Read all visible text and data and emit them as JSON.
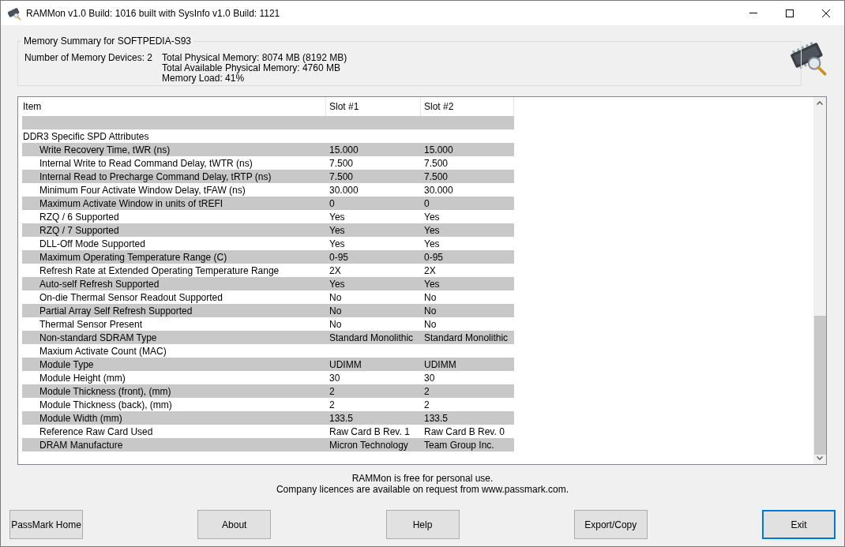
{
  "window": {
    "title": "RAMMon v1.0 Build: 1016 built with SysInfo v1.0 Build: 1121"
  },
  "summary": {
    "title": "Memory Summary for SOFTPEDIA-S93",
    "devices": "Number of Memory Devices: 2",
    "lines": [
      "Total Physical Memory: 8074 MB (8192 MB)",
      "Total Available Physical Memory: 4760 MB",
      "Memory Load: 41%"
    ]
  },
  "table": {
    "columns": [
      "Item",
      "Slot #1",
      "Slot #2"
    ],
    "rows": [
      {
        "kind": "blank",
        "cells": []
      },
      {
        "kind": "section",
        "cells": [
          "DDR3 Specific SPD Attributes"
        ]
      },
      {
        "kind": "attribute",
        "cells": [
          "Write Recovery Time, tWR (ns)",
          "15.000",
          "15.000"
        ]
      },
      {
        "kind": "attribute",
        "cells": [
          "Internal Write to Read Command Delay, tWTR (ns)",
          "7.500",
          "7.500"
        ]
      },
      {
        "kind": "attribute",
        "cells": [
          "Internal Read to Precharge Command Delay, tRTP (ns)",
          "7.500",
          "7.500"
        ]
      },
      {
        "kind": "attribute",
        "cells": [
          "Minimum Four Activate Window Delay, tFAW (ns)",
          "30.000",
          "30.000"
        ]
      },
      {
        "kind": "attribute",
        "cells": [
          "Maximum Activate Window in units of tREFI",
          "0",
          "0"
        ]
      },
      {
        "kind": "attribute",
        "cells": [
          "RZQ / 6 Supported",
          "Yes",
          "Yes"
        ]
      },
      {
        "kind": "attribute",
        "cells": [
          "RZQ / 7 Supported",
          "Yes",
          "Yes"
        ]
      },
      {
        "kind": "attribute",
        "cells": [
          "DLL-Off Mode Supported",
          "Yes",
          "Yes"
        ]
      },
      {
        "kind": "attribute",
        "cells": [
          "Maximum Operating Temperature Range (C)",
          "0-95",
          "0-95"
        ]
      },
      {
        "kind": "attribute",
        "cells": [
          "Refresh Rate at Extended Operating Temperature Range",
          "2X",
          "2X"
        ]
      },
      {
        "kind": "attribute",
        "cells": [
          "Auto-self Refresh Supported",
          "Yes",
          "Yes"
        ]
      },
      {
        "kind": "attribute",
        "cells": [
          "On-die Thermal Sensor Readout Supported",
          "No",
          "No"
        ]
      },
      {
        "kind": "attribute",
        "cells": [
          "Partial Array Self Refresh Supported",
          "No",
          "No"
        ]
      },
      {
        "kind": "attribute",
        "cells": [
          "Thermal Sensor Present",
          "No",
          "No"
        ]
      },
      {
        "kind": "attribute",
        "cells": [
          "Non-standard SDRAM Type",
          "Standard Monolithic",
          "Standard Monolithic"
        ]
      },
      {
        "kind": "attribute",
        "cells": [
          "Maxium Activate Count (MAC)"
        ]
      },
      {
        "kind": "attribute",
        "cells": [
          "Module Type",
          "UDIMM",
          "UDIMM"
        ]
      },
      {
        "kind": "attribute",
        "cells": [
          "Module Height (mm)",
          "30",
          "30"
        ]
      },
      {
        "kind": "attribute",
        "cells": [
          "Module Thickness (front), (mm)",
          "2",
          "2"
        ]
      },
      {
        "kind": "attribute",
        "cells": [
          "Module Thickness (back), (mm)",
          "2",
          "2"
        ]
      },
      {
        "kind": "attribute",
        "cells": [
          "Module Width (mm)",
          "133.5",
          "133.5"
        ]
      },
      {
        "kind": "attribute",
        "cells": [
          "Reference Raw Card Used",
          "Raw Card B Rev. 1",
          "Raw Card B Rev. 0"
        ]
      },
      {
        "kind": "attribute",
        "cells": [
          "DRAM Manufacture",
          "Micron Technology",
          "Team Group Inc."
        ]
      }
    ]
  },
  "footer": [
    "RAMMon is free for personal use.",
    "Company licences are available on request from www.passmark.com."
  ],
  "buttons": [
    {
      "label": "PassMark Home",
      "default": false
    },
    {
      "label": "About",
      "default": false
    },
    {
      "label": "Help",
      "default": false
    },
    {
      "label": "Export/Copy",
      "default": false
    },
    {
      "label": "Exit",
      "default": true
    }
  ]
}
